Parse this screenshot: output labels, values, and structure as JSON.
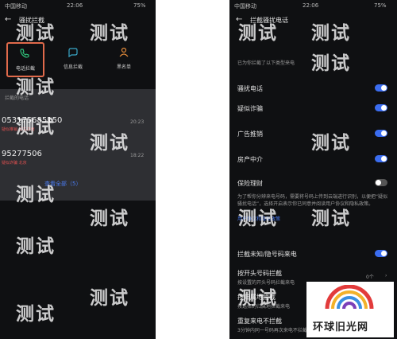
{
  "left": {
    "status": {
      "carrier": "中国移动",
      "time": "22:06",
      "right": "75%"
    },
    "title": "骚扰拦截",
    "tabs": [
      {
        "label": "电话拦截",
        "icon": "phone-block-icon"
      },
      {
        "label": "信息拦截",
        "icon": "message-block-icon"
      },
      {
        "label": "黑名单",
        "icon": "user-list-icon"
      }
    ],
    "section_label": "拦截的电话",
    "calls": [
      {
        "number": "053175685150",
        "info": "疑似推销 山东济南",
        "time": "20:23"
      },
      {
        "number": "95277506",
        "info": "疑似诈骗 北京",
        "time": "18:22"
      }
    ],
    "view_all": "查看全部（5）"
  },
  "right": {
    "status": {
      "carrier": "中国移动",
      "time": "22:06",
      "right": "75%"
    },
    "title": "拦截骚扰电话",
    "top_note": "已为你拦截了以下类型来电",
    "items": [
      {
        "label": "骚扰电话",
        "on": true
      },
      {
        "label": "疑似诈骗",
        "on": true
      },
      {
        "label": "广告推销",
        "on": true
      },
      {
        "label": "房产中介",
        "on": true
      },
      {
        "label": "保险理财",
        "on": false
      }
    ],
    "desc": "为了帮你分辨来电号码，需要将号码上传到云端进行识别，以便把“疑似骚扰电话”，选择开启表示你已同意并阅读用户协议和隐私政策。",
    "link": "用户协议和隐私政策",
    "unknown_label": "拦截未知/隐号码来电",
    "prefix_title": "按开头号码拦截",
    "prefix_sub": "按设置的开头号码拦截来电",
    "prefix_count": "0个",
    "region_title": "按归属地拦截",
    "region_sub": "按选择的归属地拦截来电",
    "repeat_title": "重复来电不拦截",
    "repeat_sub": "3分钟内同一号码再次来电不拦截"
  },
  "watermark_text": "测试",
  "logo_text": "环球旧光网"
}
